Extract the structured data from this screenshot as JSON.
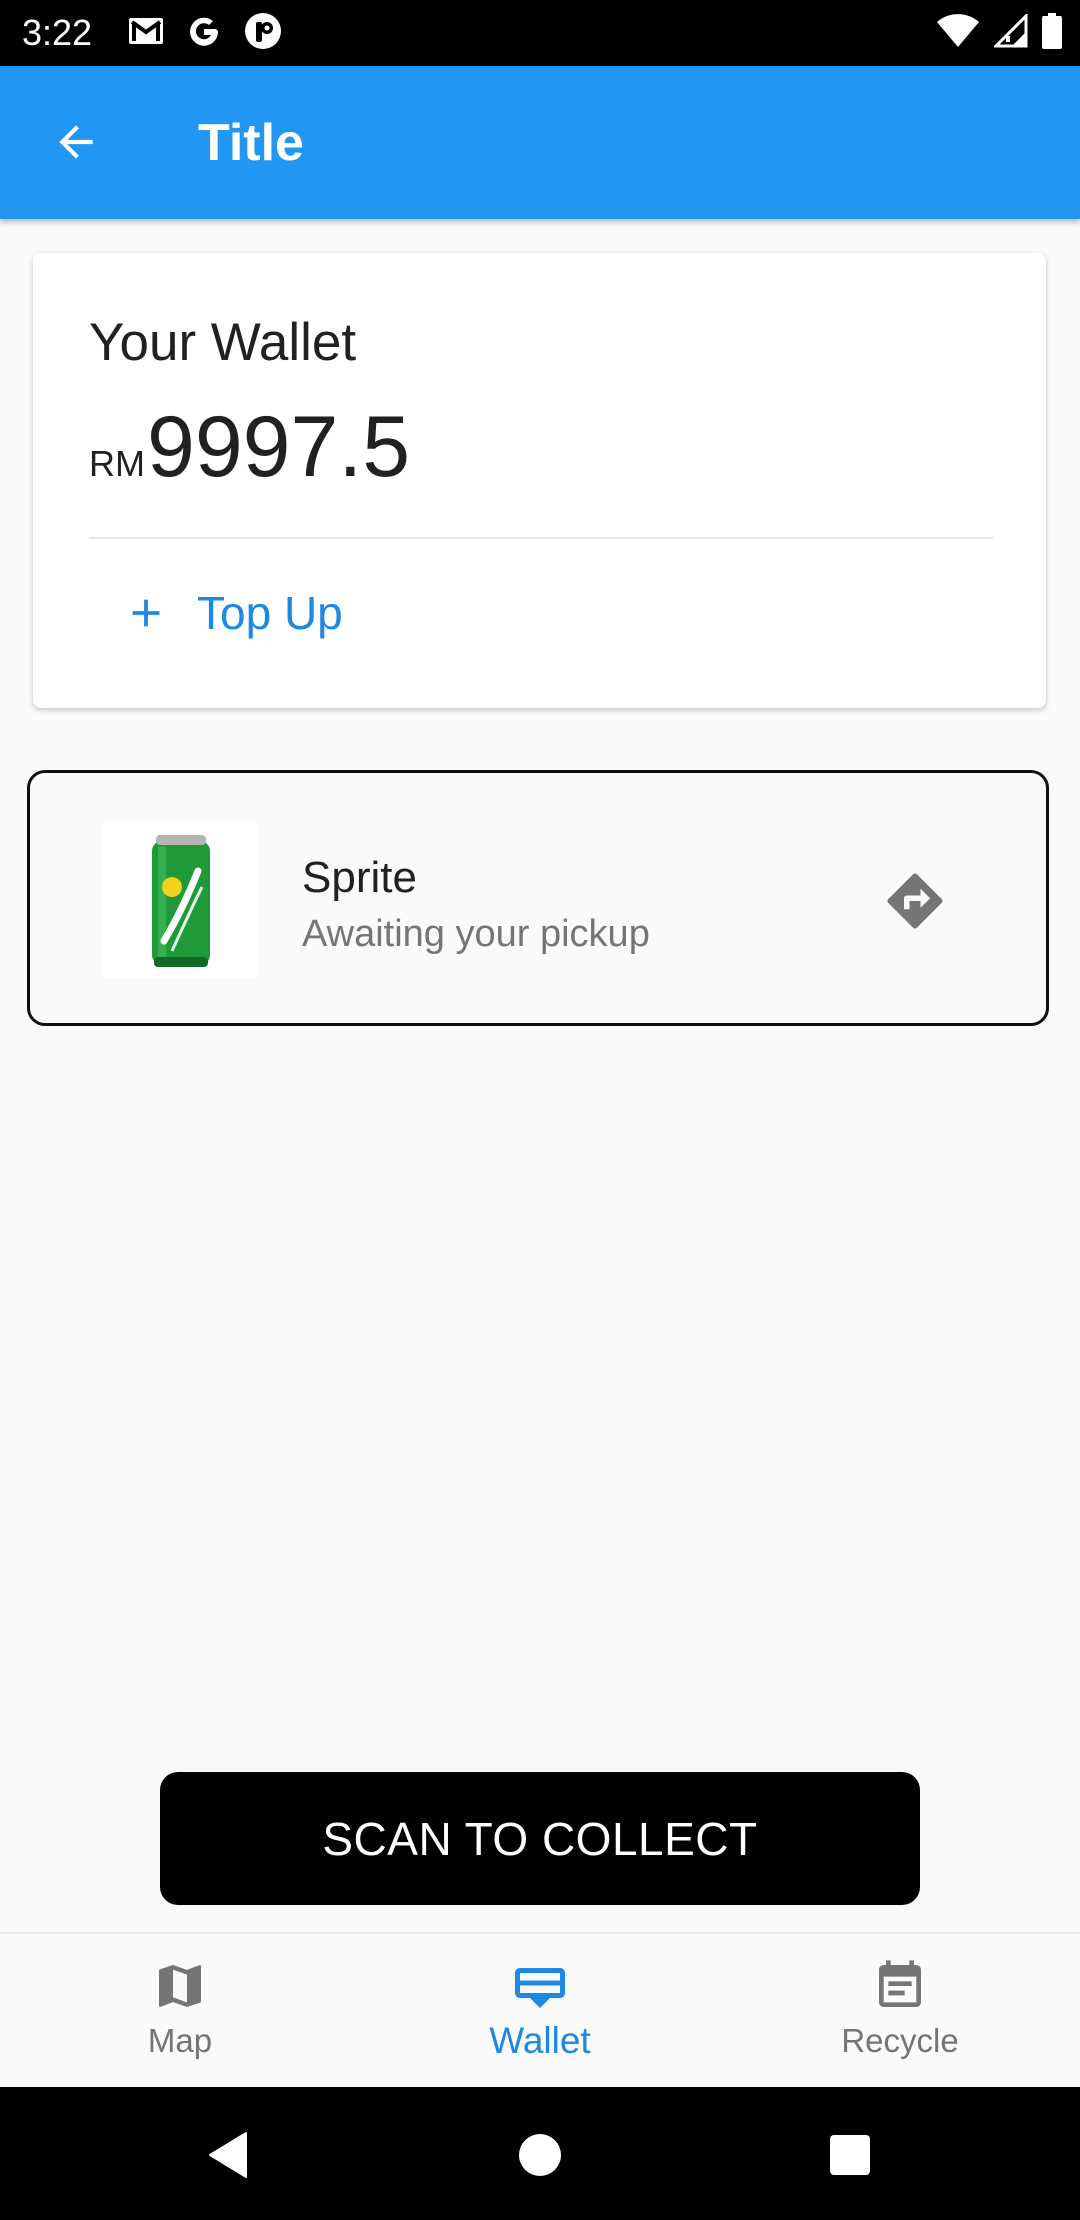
{
  "status_bar": {
    "time": "3:22",
    "left_icons": [
      "gmail-icon",
      "google-icon",
      "notification-app-icon"
    ],
    "right_icons": [
      "wifi-icon",
      "cellular-signal-icon",
      "battery-icon"
    ]
  },
  "app_bar": {
    "title": "Title",
    "back_icon": "arrow-back-icon",
    "color": "#2196f3"
  },
  "wallet": {
    "label": "Your Wallet",
    "currency": "RM",
    "balance": "9997.5",
    "top_up_label": "Top Up",
    "accent": "#1e88e5"
  },
  "items": [
    {
      "title": "Sprite",
      "status": "Awaiting your pickup",
      "thumbnail_icon": "sprite-can-image",
      "action_icon": "directions-icon"
    }
  ],
  "scan_button": {
    "label": "SCAN TO COLLECT"
  },
  "bottom_nav": {
    "active": "Wallet",
    "items": [
      {
        "label": "Map",
        "icon": "map-icon"
      },
      {
        "label": "Wallet",
        "icon": "wallet-icon"
      },
      {
        "label": "Recycle",
        "icon": "event-note-icon"
      }
    ]
  },
  "system_nav": [
    "back-triangle-icon",
    "home-circle-icon",
    "recents-square-icon"
  ]
}
